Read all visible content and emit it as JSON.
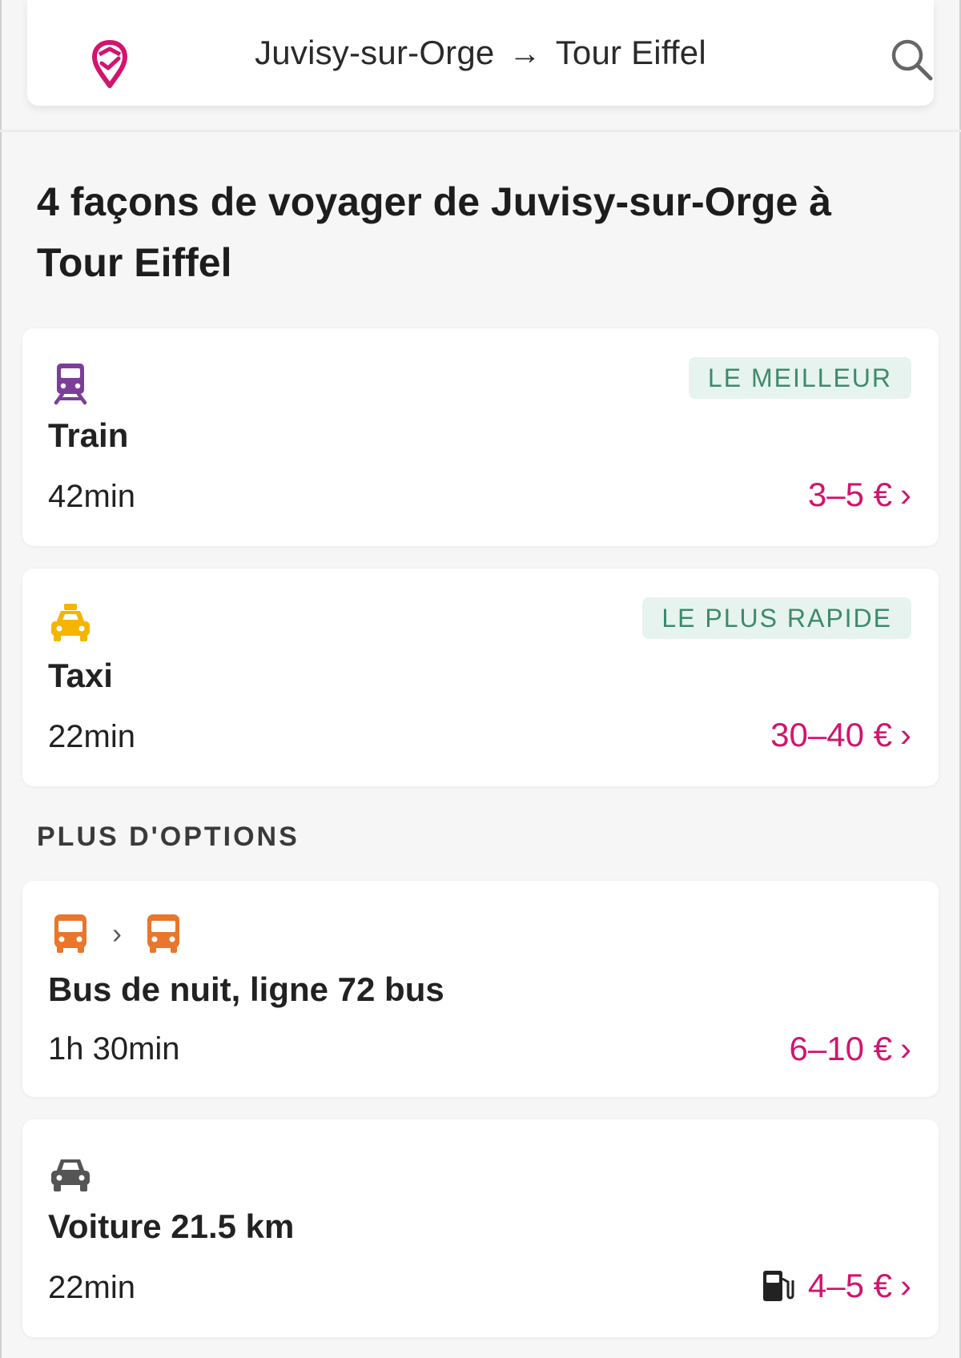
{
  "header": {
    "origin": "Juvisy-sur-Orge",
    "arrow": "→",
    "destination": "Tour Eiffel"
  },
  "title": "4 façons de voyager de Juvisy-sur-Orge à Tour Eiffel",
  "options": [
    {
      "mode": "Train",
      "icon": "train-icon",
      "icon_color": "#7b3f98",
      "badge": "LE MEILLEUR",
      "duration": "42min",
      "price": "3–5 €"
    },
    {
      "mode": "Taxi",
      "icon": "taxi-icon",
      "icon_color": "#f4b400",
      "badge": "LE PLUS RAPIDE",
      "duration": "22min",
      "price": "30–40 €"
    }
  ],
  "more_label": "PLUS D'OPTIONS",
  "more_options": [
    {
      "mode": "Bus de nuit, ligne 72 bus",
      "icons": [
        "bus-icon",
        "bus-icon"
      ],
      "icon_color": "#e9762b",
      "separator": "›",
      "duration": "1h 30min",
      "price": "6–10 €"
    },
    {
      "mode": "Voiture 21.5 km",
      "icon": "car-icon",
      "icon_color": "#555555",
      "extra_icon": "fuel-pump-icon",
      "duration": "22min",
      "price": "4–5 €"
    }
  ],
  "colors": {
    "brand": "#d2146e",
    "badge_bg": "#e7f3ee",
    "badge_text": "#3d8a6c",
    "background": "#f6f6f6"
  },
  "chevron": "›"
}
